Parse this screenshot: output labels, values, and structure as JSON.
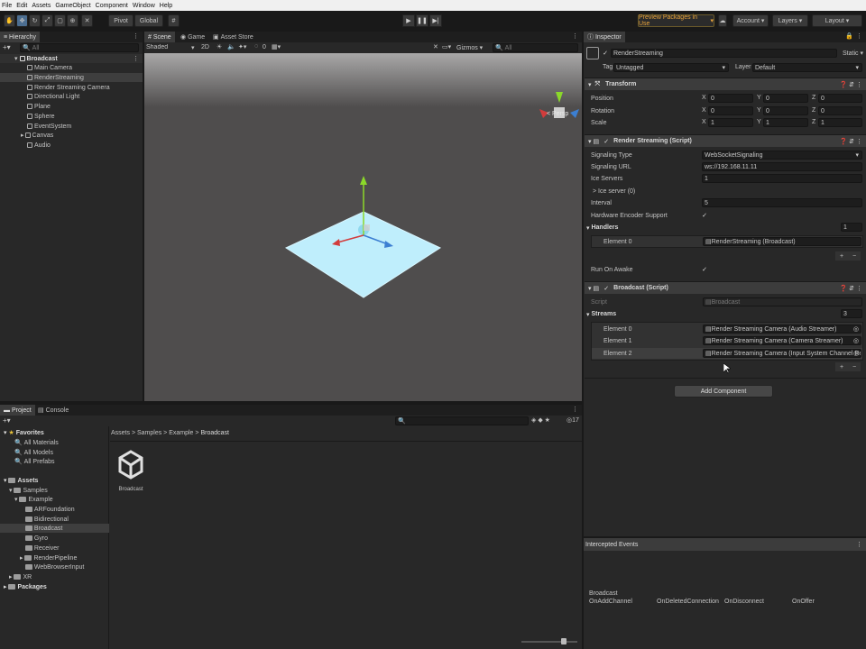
{
  "menu": [
    "File",
    "Edit",
    "Assets",
    "GameObject",
    "Component",
    "Window",
    "Help"
  ],
  "toolbar": {
    "pivot": "Pivot",
    "global": "Global",
    "preview_packages": "Preview Packages in Use",
    "account": "Account",
    "layers": "Layers",
    "layout": "Layout"
  },
  "hierarchy": {
    "tab": "Hierarchy",
    "search_placeholder": "All",
    "root": "Broadcast",
    "items": [
      "Main Camera",
      "RenderStreaming",
      "Render Streaming Camera",
      "Directional Light",
      "Plane",
      "Sphere",
      "EventSystem",
      "Canvas",
      "Audio"
    ]
  },
  "scene": {
    "tabs": [
      "Scene",
      "Game",
      "Asset Store"
    ],
    "shading": "Shaded",
    "mode_2d": "2D",
    "gizmo_count": "0",
    "gizmos": "Gizmos",
    "search_placeholder": "All",
    "persp": "< Persp"
  },
  "inspector": {
    "tab": "Inspector",
    "object_name": "RenderStreaming",
    "static_label": "Static",
    "tag_label": "Tag",
    "tag_value": "Untagged",
    "layer_label": "Layer",
    "layer_value": "Default",
    "transform": {
      "title": "Transform",
      "rows": [
        {
          "label": "Position",
          "x": "0",
          "y": "0",
          "z": "0"
        },
        {
          "label": "Rotation",
          "x": "0",
          "y": "0",
          "z": "0"
        },
        {
          "label": "Scale",
          "x": "1",
          "y": "1",
          "z": "1"
        }
      ]
    },
    "render_streaming": {
      "title": "Render Streaming (Script)",
      "signaling_type_label": "Signaling Type",
      "signaling_type": "WebSocketSignaling",
      "signaling_url_label": "Signaling URL",
      "signaling_url": "ws://192.168.11.11",
      "ice_servers_label": "Ice Servers",
      "ice_servers_count": "1",
      "ice_server_item": "> Ice server (0)",
      "interval_label": "Interval",
      "interval": "5",
      "hw_encoder_label": "Hardware Encoder Support",
      "handlers_label": "Handlers",
      "handlers_count": "1",
      "handler_element_label": "Element 0",
      "handler_element_value": "RenderStreaming (Broadcast)",
      "run_on_awake_label": "Run On Awake"
    },
    "broadcast": {
      "title": "Broadcast (Script)",
      "script_label": "Script",
      "script_value": "Broadcast",
      "streams_label": "Streams",
      "streams_count": "3",
      "elements": [
        {
          "label": "Element 0",
          "value": "Render Streaming Camera (Audio Streamer)"
        },
        {
          "label": "Element 1",
          "value": "Render Streaming Camera (Camera Streamer)"
        },
        {
          "label": "Element 2",
          "value": "Render Streaming Camera (Input System Channel Recei"
        }
      ]
    },
    "add_component": "Add Component",
    "plus": "+",
    "minus": "−"
  },
  "project": {
    "tabs": [
      "Project",
      "Console"
    ],
    "favorites": "Favorites",
    "fav_items": [
      "All Materials",
      "All Models",
      "All Prefabs"
    ],
    "assets": "Assets",
    "samples": "Samples",
    "example": "Example",
    "example_children": [
      "ARFoundation",
      "Bidirectional",
      "Broadcast",
      "Gyro",
      "Receiver",
      "RenderPipeline",
      "WebBrowserInput"
    ],
    "xr": "XR",
    "packages": "Packages",
    "breadcrumb": [
      "Assets",
      "Samples",
      "Example",
      "Broadcast"
    ],
    "asset_name": "Broadcast",
    "hidden_count": "17"
  },
  "events": {
    "title": "Intercepted Events",
    "group": "Broadcast",
    "items": [
      "OnAddChannel",
      "OnDeletedConnection",
      "OnDisconnect",
      "OnOffer"
    ]
  },
  "colors": {
    "accent": "#4c6e91",
    "preview_text": "#e8a33a",
    "plane": "#bfeefc"
  }
}
